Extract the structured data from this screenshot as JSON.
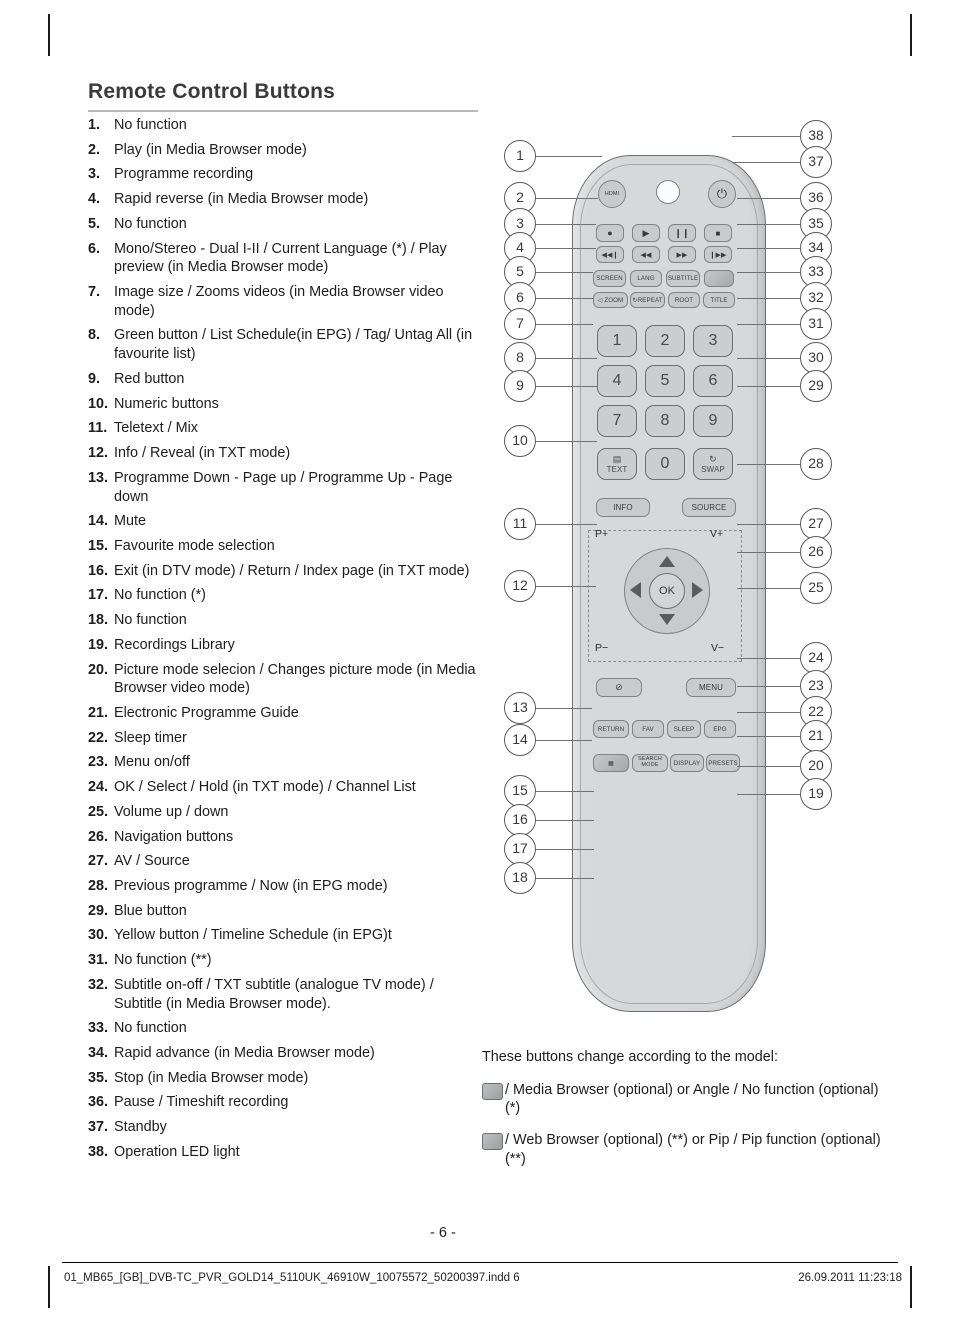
{
  "document": {
    "title": "Remote Control Buttons",
    "page_number": "- 6 -"
  },
  "buttons": [
    {
      "num": "1.",
      "text": "No function"
    },
    {
      "num": "2.",
      "text": "Play (in Media Browser mode)"
    },
    {
      "num": "3.",
      "text": "Programme recording"
    },
    {
      "num": "4.",
      "text": "Rapid reverse (in Media Browser mode)"
    },
    {
      "num": "5.",
      "text": "No function"
    },
    {
      "num": "6.",
      "text": "Mono/Stereo - Dual I-II / Current Language (*) / Play preview (in Media Browser mode)"
    },
    {
      "num": "7.",
      "text": "Image size / Zooms videos (in Media Browser video mode)"
    },
    {
      "num": "8.",
      "text": "Green button / List Schedule(in EPG) / Tag/ Untag All (in favourite list)"
    },
    {
      "num": "9.",
      "text": "Red button"
    },
    {
      "num": "10.",
      "text": "Numeric buttons"
    },
    {
      "num": "11.",
      "text": "Teletext / Mix"
    },
    {
      "num": "12.",
      "text": "Info / Reveal (in TXT mode)"
    },
    {
      "num": "13.",
      "text": "Programme Down - Page up / Programme Up - Page down"
    },
    {
      "num": "14.",
      "text": "Mute"
    },
    {
      "num": "15.",
      "text": "Favourite mode selection"
    },
    {
      "num": "16.",
      "text": "Exit (in DTV mode) / Return / Index page (in TXT mode)"
    },
    {
      "num": "17.",
      "text": "No function (*)"
    },
    {
      "num": "18.",
      "text": "No function"
    },
    {
      "num": "19.",
      "text": "Recordings Library"
    },
    {
      "num": "20.",
      "text": "Picture mode selecion / Changes picture mode (in Media Browser video mode)"
    },
    {
      "num": "21.",
      "text": "Electronic Programme Guide"
    },
    {
      "num": "22.",
      "text": "Sleep timer"
    },
    {
      "num": "23.",
      "text": "Menu on/off"
    },
    {
      "num": "24.",
      "text": "OK / Select / Hold (in TXT mode) / Channel List"
    },
    {
      "num": "25.",
      "text": "Volume up / down"
    },
    {
      "num": "26.",
      "text": "Navigation buttons"
    },
    {
      "num": "27.",
      "text": "AV / Source"
    },
    {
      "num": "28.",
      "text": "Previous programme / Now (in EPG mode)"
    },
    {
      "num": "29.",
      "text": "Blue button"
    },
    {
      "num": "30.",
      "text": "Yellow button / Timeline Schedule (in EPG)t"
    },
    {
      "num": "31.",
      "text": "No function (**)"
    },
    {
      "num": "32.",
      "text": "Subtitle on-off / TXT subtitle (analogue TV mode) / Subtitle (in Media Browser mode)."
    },
    {
      "num": "33.",
      "text": "No function"
    },
    {
      "num": "34.",
      "text": "Rapid advance (in Media Browser mode)"
    },
    {
      "num": "35.",
      "text": "Stop (in Media Browser mode)"
    },
    {
      "num": "36.",
      "text": "Pause / Timeshift recording"
    },
    {
      "num": "37.",
      "text": "Standby"
    },
    {
      "num": "38.",
      "text": "Operation LED light"
    }
  ],
  "figure": {
    "callouts_left": [
      "1",
      "2",
      "3",
      "4",
      "5",
      "6",
      "7",
      "8",
      "9",
      "10",
      "11",
      "12",
      "13",
      "14",
      "15",
      "16",
      "17",
      "18"
    ],
    "callouts_right": [
      "38",
      "37",
      "36",
      "35",
      "34",
      "33",
      "32",
      "31",
      "30",
      "29",
      "28",
      "27",
      "26",
      "25",
      "24",
      "23",
      "22",
      "21",
      "20",
      "19"
    ],
    "keys": {
      "hdmi": "HDMI",
      "power": "power-symbol",
      "record": "record-dot",
      "play": "play",
      "pause": "pause",
      "stop": "stop",
      "prev": "skip-back",
      "rew": "rewind",
      "ff": "fast-forward",
      "next": "skip-forward",
      "screen": "SCREEN",
      "lang": "LANG",
      "subtitle": "SUBTITLE",
      "webbrowser": "web-browser",
      "zoom": "ZOOM",
      "repeat": "REPEAT",
      "root": "ROOT",
      "title": "TITLE",
      "numbers": [
        "1",
        "2",
        "3",
        "4",
        "5",
        "6",
        "7",
        "8",
        "9"
      ],
      "text": "TEXT",
      "zero": "0",
      "swap": "SWAP",
      "info": "INFO",
      "source": "SOURCE",
      "p_plus": "P+",
      "v_plus": "V+",
      "p_minus": "P−",
      "v_minus": "V−",
      "ok": "OK",
      "mute": "mute",
      "menu": "MENU",
      "return": "RETURN",
      "fav": "FAV",
      "sleep": "SLEEP",
      "epg": "EPG",
      "media_browser": "media-browser",
      "search_mode": "SEARCH MODE",
      "display": "DISPLAY",
      "presets": "PRESETS"
    }
  },
  "notes": {
    "intro": "These buttons change according to the model:",
    "items": [
      "/ Media Browser (optional) or Angle / No function (optional) (*)",
      "/ Web Browser (optional) (**) or Pip / Pip function (optional) (**)"
    ]
  },
  "footer": {
    "left": "01_MB65_[GB]_DVB-TC_PVR_GOLD14_5110UK_46910W_10075572_50200397.indd   6",
    "right": "26.09.2011   11:23:18"
  }
}
